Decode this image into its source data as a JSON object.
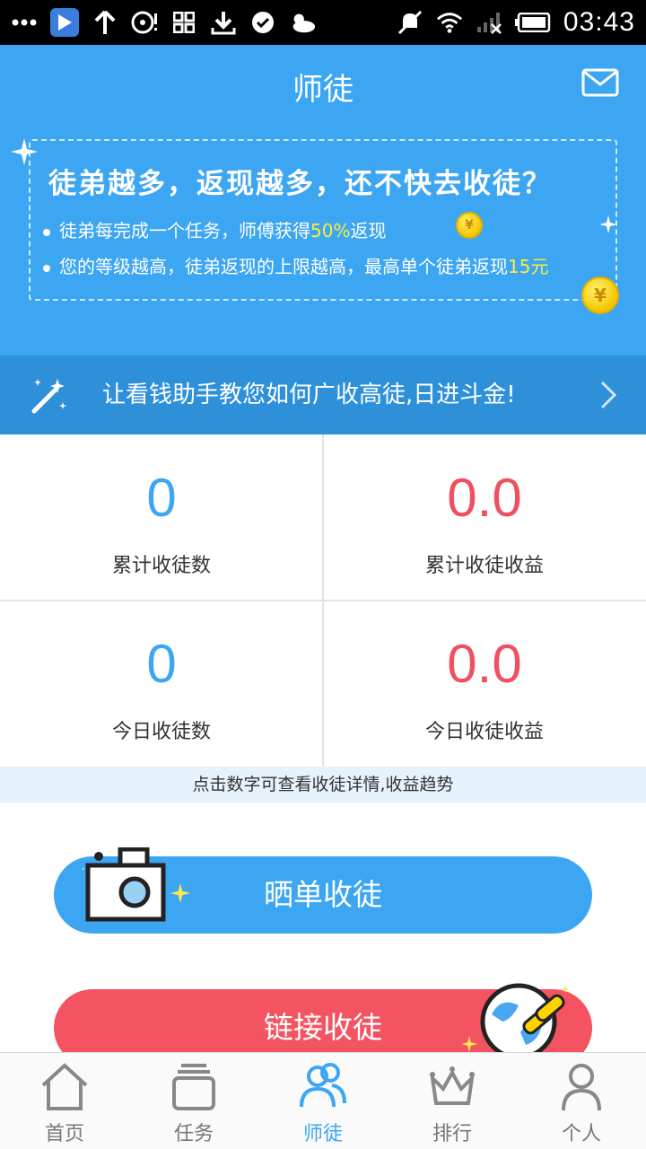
{
  "status_bar": {
    "time": "03:43",
    "icons": [
      "more-dots-icon",
      "media-player-icon",
      "upload-arrow-icon",
      "disc-icon",
      "app-grid-icon",
      "download-icon",
      "check-circle-icon",
      "weather-cloud-icon",
      "silent-bell-icon",
      "wifi-icon",
      "signal-icon",
      "battery-icon"
    ]
  },
  "header": {
    "title": "师徒",
    "mail_icon": "mail-icon",
    "headline": "徒弟越多，返现越多，还不快去收徒？",
    "line1_prefix": "徒弟每完成一个任务，师傅获得",
    "line1_highlight": "50%",
    "line1_suffix": "返现",
    "line2_prefix": "您的等级越高，徒弟返现的上限越高，最高单个徒弟返现",
    "line2_highlight": "15元",
    "coin_symbol": "¥",
    "highlight_color": "#ffeb3b",
    "background_color": "#3da6f3"
  },
  "tutorial": {
    "text": "让看钱助手教您如何广收高徒,日进斗金!",
    "icon": "magic-wand-icon"
  },
  "stats": [
    {
      "value": "0",
      "label": "累计收徒数",
      "color": "#3da6f3"
    },
    {
      "value": "0.0",
      "label": "累计收徒收益",
      "color": "#f0505f"
    },
    {
      "value": "0",
      "label": "今日收徒数",
      "color": "#3da6f3"
    },
    {
      "value": "0.0",
      "label": "今日收徒收益",
      "color": "#f0505f"
    }
  ],
  "hint": "点击数字可查看收徒详情,收益趋势",
  "actions": {
    "share_label": "晒单收徒",
    "link_label": "链接收徒",
    "share_color": "#3da6f3",
    "link_color": "#f45462"
  },
  "nav": [
    {
      "label": "首页",
      "icon": "home-icon",
      "active": false
    },
    {
      "label": "任务",
      "icon": "task-stack-icon",
      "active": false
    },
    {
      "label": "师徒",
      "icon": "people-icon",
      "active": true
    },
    {
      "label": "排行",
      "icon": "crown-icon",
      "active": false
    },
    {
      "label": "个人",
      "icon": "person-icon",
      "active": false
    }
  ]
}
